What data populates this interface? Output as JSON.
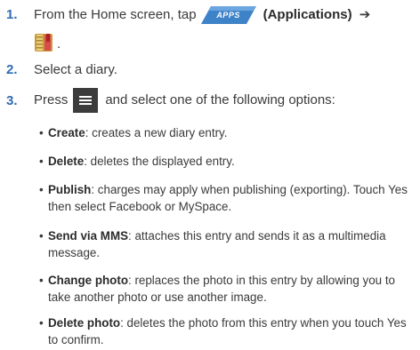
{
  "steps": [
    {
      "number": "1.",
      "text_before": "From the Home screen, tap",
      "apps_button": "APPS",
      "applications": "(Applications)",
      "arrow": "➔",
      "period": "."
    },
    {
      "number": "2.",
      "text": "Select a diary."
    },
    {
      "number": "3.",
      "text_before": "Press",
      "text_after": "and select one of the following options:"
    }
  ],
  "options": [
    {
      "label": "Create",
      "description": ": creates a new diary entry."
    },
    {
      "label": "Delete",
      "description": ": deletes the displayed entry."
    },
    {
      "label": "Publish",
      "description": ": charges may apply when publishing (exporting). Touch Yes then select Facebook or MySpace."
    },
    {
      "label": "Send via MMS",
      "description": ": attaches this entry and sends it as a multimedia message."
    },
    {
      "label": "Change photo",
      "description": ": replaces the photo in this entry by allowing you to take another photo or use another image."
    },
    {
      "label": "Delete photo",
      "description": ": deletes the photo from this entry when you touch Yes to confirm."
    }
  ],
  "bullet_char": "•",
  "icons": {
    "apps": "apps-button-icon",
    "diary": "diary-app-icon",
    "menu": "menu-key-icon"
  },
  "colors": {
    "step_number": "#2f6bb0",
    "apps_button": "#3e82c8",
    "menu_key": "#3c3c3c"
  }
}
